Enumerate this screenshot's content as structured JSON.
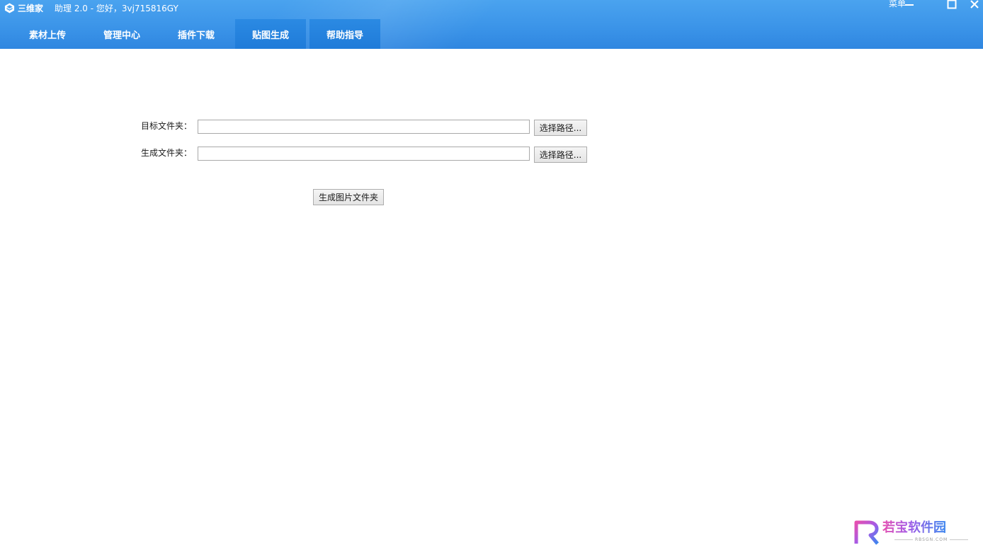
{
  "window": {
    "app_name": "三维家",
    "subtitle": "助理 2.0 - 您好，3vj715816GY",
    "menu_label": "菜单",
    "controls": {
      "minimize_icon": "minimize-icon",
      "maximize_icon": "maximize-icon",
      "close_icon": "close-icon"
    }
  },
  "nav": {
    "tabs": [
      {
        "label": "素材上传",
        "active": false
      },
      {
        "label": "管理中心",
        "active": false
      },
      {
        "label": "插件下载",
        "active": false
      },
      {
        "label": "贴图生成",
        "active": true
      },
      {
        "label": "帮助指导",
        "active": true
      }
    ]
  },
  "form": {
    "target_folder": {
      "label": "目标文件夹：",
      "value": "",
      "browse_label": "选择路径..."
    },
    "output_folder": {
      "label": "生成文件夹：",
      "value": "",
      "browse_label": "选择路径..."
    },
    "generate_label": "生成图片文件夹"
  },
  "watermark": {
    "text": "若宝软件园",
    "sub": "RBSGN.COM"
  },
  "colors": {
    "header_blue": "#3a93e8",
    "tab_active": "#2383dd",
    "watermark_pink": "#e64fb0",
    "watermark_blue": "#3a86ee"
  }
}
